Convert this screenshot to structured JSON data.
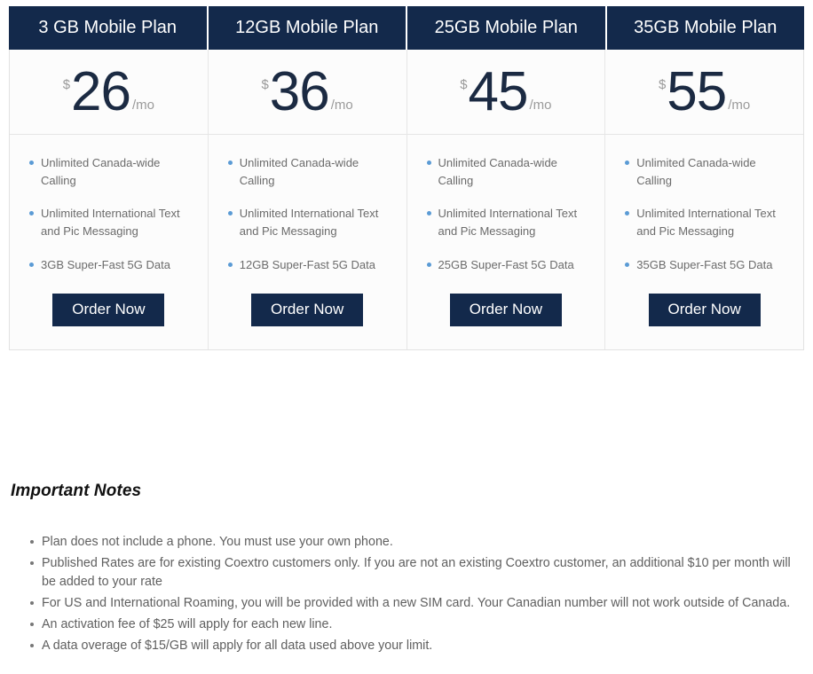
{
  "pricing_table": {
    "currency_symbol": "$",
    "period_suffix": "/mo",
    "order_button_label": "Order Now",
    "accent_color": "#13294b",
    "bullet_color": "#5b9bd5",
    "plans": [
      {
        "header": "3 GB Mobile Plan",
        "price": "26",
        "features": [
          "Unlimited Canada-wide Calling",
          "Unlimited International Text and Pic Messaging",
          "3GB Super-Fast 5G Data"
        ]
      },
      {
        "header": "12GB Mobile Plan",
        "price": "36",
        "features": [
          "Unlimited Canada-wide Calling",
          "Unlimited International Text and Pic Messaging",
          "12GB Super-Fast 5G Data"
        ]
      },
      {
        "header": "25GB Mobile Plan",
        "price": "45",
        "features": [
          "Unlimited Canada-wide Calling",
          "Unlimited International Text and Pic Messaging",
          "25GB Super-Fast 5G Data"
        ]
      },
      {
        "header": "35GB Mobile Plan",
        "price": "55",
        "features": [
          "Unlimited Canada-wide Calling",
          "Unlimited International Text and Pic Messaging",
          "35GB Super-Fast 5G Data"
        ]
      }
    ]
  },
  "notes": {
    "title": "Important Notes",
    "items": [
      "Plan does not include a phone. You must use your own phone.",
      "Published Rates are for existing Coextro customers only. If you are not an existing Coextro customer, an additional $10 per month will be added to your rate",
      "For US and International Roaming, you will be provided with a new SIM card. Your Canadian number will not work outside of Canada.",
      "An activation fee of $25 will apply for each new line.",
      "A data overage of $15/GB will apply for all data used above your limit."
    ]
  }
}
